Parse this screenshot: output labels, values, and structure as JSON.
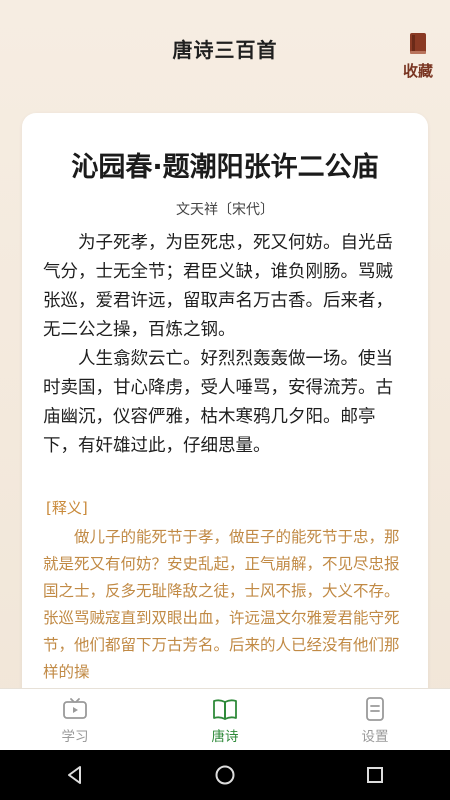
{
  "header": {
    "title": "唐诗三百首",
    "favorite_label": "收藏"
  },
  "poem": {
    "title": "沁园春·题潮阳张许二公庙",
    "author": "文天祥〔宋代〕",
    "paragraphs": [
      "为子死孝，为臣死忠，死又何妨。自光岳气分，士无全节；君臣义缺，谁负刚肠。骂贼张巡，爱君许远，留取声名万古香。后来者，无二公之操，百炼之钢。",
      "人生翕欻云亡。好烈烈轰轰做一场。使当时卖国，甘心降虏，受人唾骂，安得流芳。古庙幽沉，仪容俨雅，枯木寒鸦几夕阳。邮亭下，有奸雄过此，仔细思量。"
    ]
  },
  "explanation": {
    "label": "[释义]",
    "text": "做儿子的能死节于孝，做臣子的能死节于忠，那就是死又有何妨？安史乱起，正气崩解，不见尽忠报国之士，反多无耻降敌之徒，士风不振，大义不存。张巡骂贼寇直到双眼出血，许远温文尔雅爱君能守死节，他们都留下万古芳名。后来的人已经没有他们那样的操"
  },
  "tabbar": {
    "tabs": [
      {
        "label": "学习",
        "icon": "tv-icon"
      },
      {
        "label": "唐诗",
        "icon": "book-icon"
      },
      {
        "label": "设置",
        "icon": "document-icon"
      }
    ],
    "active_index": 1
  },
  "colors": {
    "accent_green": "#2f8a3a",
    "favorite_brown": "#7a3522",
    "explanation_gold": "#c18a45",
    "background": "#f3e9dc"
  }
}
